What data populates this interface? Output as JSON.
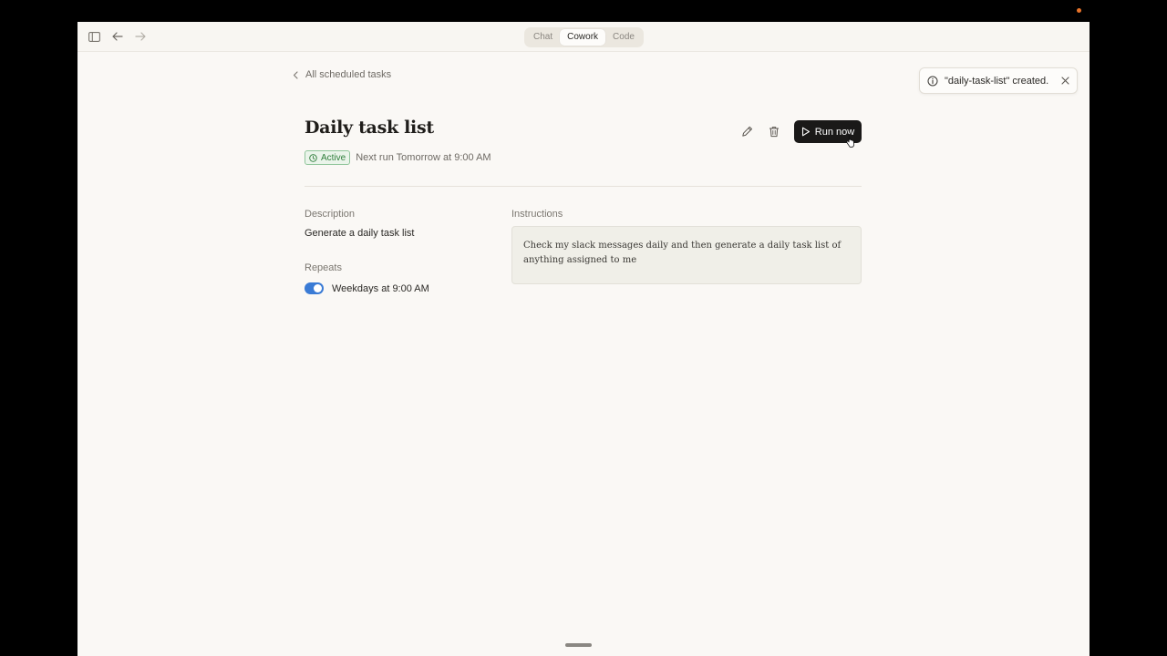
{
  "titlebar": {
    "icons": [
      "sidebar-toggle-icon",
      "back-arrow-icon",
      "forward-arrow-icon"
    ],
    "modes": [
      {
        "label": "Chat",
        "active": false
      },
      {
        "label": "Cowork",
        "active": true
      },
      {
        "label": "Code",
        "active": false
      }
    ]
  },
  "breadcrumb": {
    "back_label": "All scheduled tasks",
    "icon": "chevron-left-icon"
  },
  "task": {
    "title": "Daily task list",
    "status": "Active",
    "next_run": "Next run Tomorrow at 9:00 AM",
    "description_label": "Description",
    "description": "Generate a daily task list",
    "repeats_label": "Repeats",
    "repeats_value": "Weekdays at 9:00 AM",
    "repeats_enabled": true,
    "instructions_label": "Instructions",
    "instructions": "Check my slack messages daily and then generate a daily task list of anything assigned to me"
  },
  "actions": {
    "edit_icon": "pencil-icon",
    "delete_icon": "trash-icon",
    "run_label": "Run now"
  },
  "toast": {
    "message": "\"daily-task-list\" created.",
    "icon": "info-icon"
  },
  "colors": {
    "accent_toggle": "#3a7bd5",
    "status_green": "#2e7d3a",
    "run_button": "#1a1918",
    "background": "#faf8f5"
  }
}
